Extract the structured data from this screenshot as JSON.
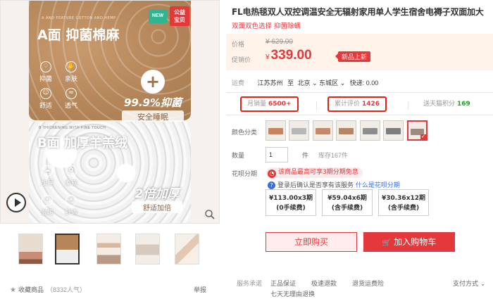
{
  "gallery": {
    "panel_a": {
      "tiny": "A AND FEATURE COTTON AND HEMP",
      "title": "A面 抑菌棉麻",
      "features": [
        "抑菌",
        "亲肤",
        "舒适",
        "透气"
      ],
      "badge_pct": "99.9%抑菌",
      "badge_strip": "安全睡眠"
    },
    "panel_b": {
      "tiny": "B THICKENING WITH FINE TOUCH",
      "title": "B面 加厚羊羔绒",
      "features": [
        "加厚",
        "柔软",
        "温暖",
        "舒适"
      ],
      "badge_big": "2倍加厚",
      "badge_strip": "舒适加倍"
    },
    "tag_new": "NEW",
    "tag_charity": "公益\n宝贝"
  },
  "bottom_left": {
    "favorite_label": "收藏商品",
    "favorite_count": "（8332人气）",
    "report": "举报"
  },
  "product": {
    "title": "FL电热毯双人双控调温安全无辐射家用单人学生宿舍电褥子双面加大",
    "subtitle": "双面双色选择 抑菌除螨"
  },
  "price": {
    "orig_label": "价格",
    "orig_value": "¥ 629.00",
    "promo_label": "促销价",
    "currency": "¥",
    "promo_value": "339.00",
    "new_badge": "新品上新"
  },
  "shipping": {
    "label": "运费",
    "from": "江苏苏州",
    "to_word": "至",
    "dest_city": "北京",
    "dest_area": "东城区",
    "fee": "快递: 0.00"
  },
  "stats": {
    "monthly_label": "月销量",
    "monthly_value": "6500+",
    "reviews_label": "累计评价",
    "reviews_value": "1426",
    "points_label": "送天猫积分",
    "points_value": "169"
  },
  "options": {
    "color_label": "颜色分类",
    "qty_label": "数量",
    "qty_value": "1",
    "qty_unit": "件",
    "stock": "库存167件",
    "installment_label": "花呗分期",
    "installment_promo": "该商品最高可享3期分期免息",
    "login_note_pre": "登录后确认是否享有该服务",
    "login_note_link": "什么是花呗分期",
    "plans": [
      {
        "price": "¥113.00x3期",
        "fee": "(0手续费)"
      },
      {
        "price": "¥59.04x6期",
        "fee": "(含手续费)"
      },
      {
        "price": "¥30.36x12期",
        "fee": "(含手续费)"
      }
    ]
  },
  "actions": {
    "buy_now": "立即购买",
    "add_cart": "加入购物车"
  },
  "service": {
    "label": "服务承诺",
    "items": [
      "正品保证",
      "极速退款",
      "退货运费险",
      "七天无理由退换"
    ],
    "pay": "支付方式 ⌄"
  },
  "colors": {
    "accent": "#e4393c",
    "highlight_border": "#e52015",
    "green": "#2a9d2a",
    "link_blue": "#3a6fd8"
  }
}
